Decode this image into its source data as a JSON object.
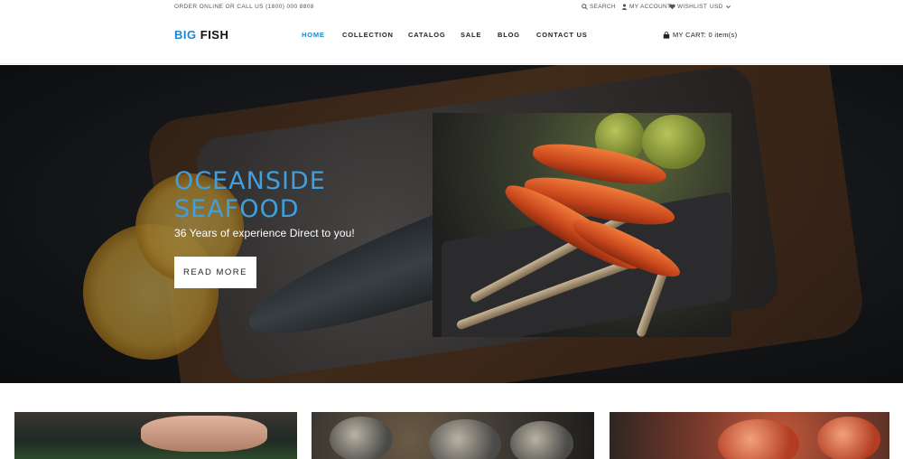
{
  "topbar": {
    "promo": "ORDER ONLINE OR CALL US (1800) 000 8808",
    "search_label": "SEARCH",
    "account_label": "MY ACCOUNT",
    "wishlist_label": "WISHLIST",
    "currency": "USD"
  },
  "header": {
    "logo_part1": "BIG",
    "logo_part2": "FISH",
    "nav": [
      {
        "label": "HOME",
        "active": true
      },
      {
        "label": "COLLECTION",
        "active": false
      },
      {
        "label": "CATALOG",
        "active": false
      },
      {
        "label": "SALE",
        "active": false
      },
      {
        "label": "BLOG",
        "active": false
      },
      {
        "label": "CONTACT US",
        "active": false
      }
    ],
    "cart_label": "MY CART: 0 item(s)"
  },
  "hero": {
    "title_line1": "OCEANSIDE",
    "title_line2": "SEAFOOD",
    "subtitle": "36 Years of experience Direct to you!",
    "button_label": "READ MORE"
  },
  "colors": {
    "accent": "#1f86c8",
    "hero_title": "#3fa0dd"
  },
  "icons": {
    "search": "search-icon",
    "account": "user-icon",
    "wishlist": "heart-icon",
    "currency_dropdown": "chevron-down-icon",
    "cart": "bag-icon"
  }
}
